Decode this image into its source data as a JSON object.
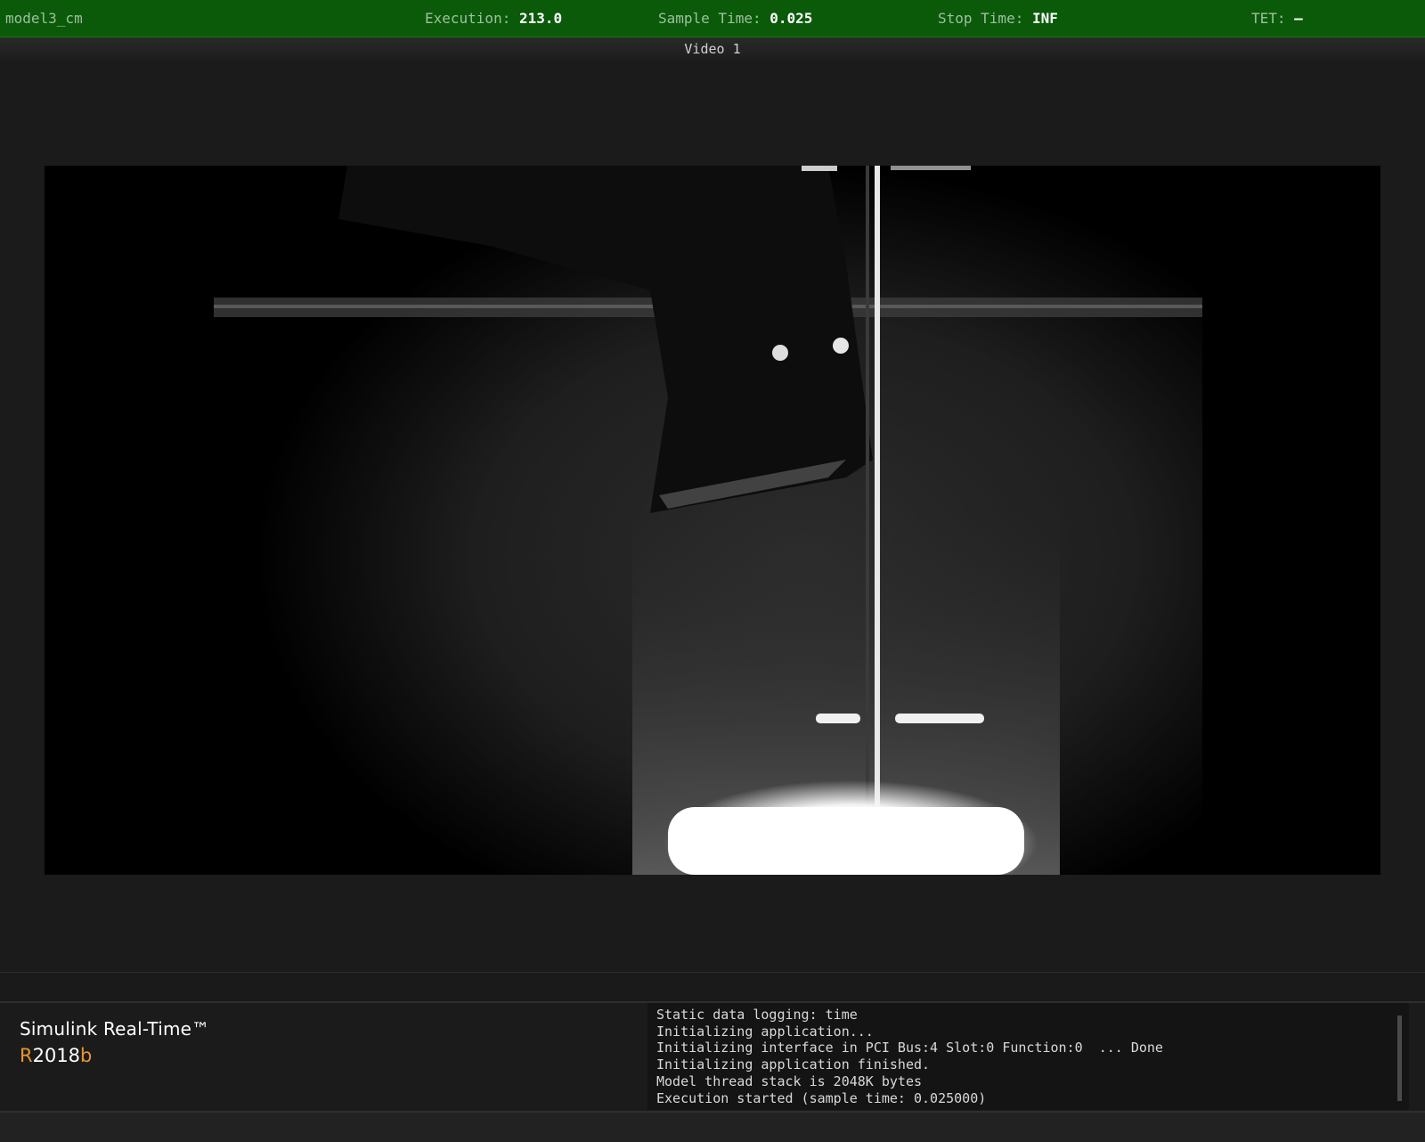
{
  "status": {
    "model_name": "model3_cm",
    "execution_label": "Execution:",
    "execution_value": "213.0",
    "sample_time_label": "Sample Time:",
    "sample_time_value": "0.025",
    "stop_time_label": "Stop Time:",
    "stop_time_value": "INF",
    "tet_label": "TET:",
    "tet_value": "–"
  },
  "video": {
    "title": "Video 1"
  },
  "brand": {
    "name": "Simulink Real-Time™",
    "release_prefix": "R",
    "release_year": "2018",
    "release_suffix": "b"
  },
  "console": {
    "lines": [
      "Static data logging: time",
      "Initializing application...",
      "Initializing interface in PCI Bus:4 Slot:0 Function:0  ... Done",
      "Initializing application finished.",
      "Model thread stack is 2048K bytes",
      "Execution started (sample time: 0.025000)"
    ]
  },
  "colors": {
    "status_bar": "#0a5a0a",
    "accent": "#e8962e",
    "background": "#1b1b1b"
  }
}
